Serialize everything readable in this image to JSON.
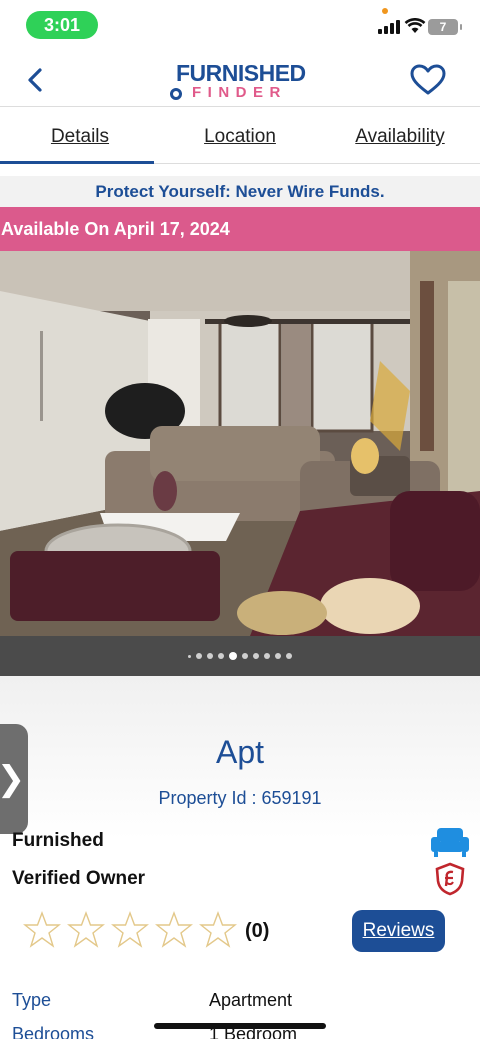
{
  "status_bar": {
    "time": "3:01",
    "battery": "7"
  },
  "header": {
    "logo_top": "FURNISHED",
    "logo_bottom": "FINDER"
  },
  "tabs": [
    {
      "label": "Details",
      "active": true
    },
    {
      "label": "Location",
      "active": false
    },
    {
      "label": "Availability",
      "active": false
    }
  ],
  "notice": {
    "warning": "Protect Yourself: Never Wire Funds.",
    "availability": "Available On April 17, 2024"
  },
  "gallery": {
    "total_photos": 10,
    "current_index": 4
  },
  "property": {
    "title": "Apt",
    "property_id": "Property Id : 659191",
    "features": [
      "Furnished",
      "Verified Owner"
    ],
    "rating_count": "(0)",
    "reviews_label": "Reviews",
    "stars_filled": 0,
    "specs": [
      {
        "label": "Type",
        "value": "Apartment"
      },
      {
        "label": "Bedrooms",
        "value": "1 Bedroom"
      }
    ]
  },
  "colors": {
    "brand": "#1d4e96",
    "accent_pink": "#db5a8c",
    "status_green": "#2fd158"
  }
}
